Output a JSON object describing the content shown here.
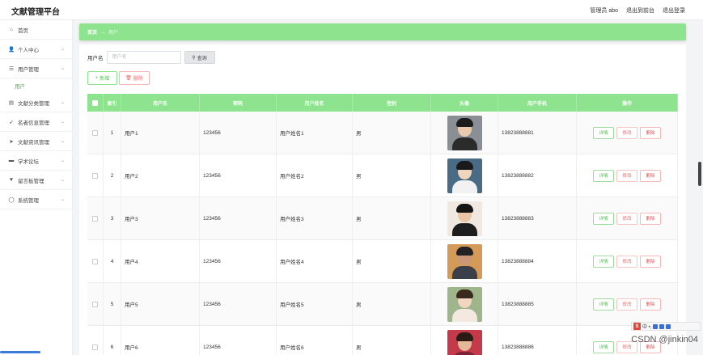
{
  "app": {
    "title": "文献管理平台",
    "top_user": "管理员 abo",
    "top_links": [
      "退出到前台",
      "退出登录"
    ]
  },
  "sidebar": {
    "items": [
      {
        "label": "首页",
        "icon": "home-icon",
        "glyph": "⌂",
        "chev": false
      },
      {
        "label": "个人中心",
        "icon": "user-icon",
        "glyph": "👤",
        "chev": true
      },
      {
        "label": "用户管理",
        "icon": "list-icon",
        "glyph": "☰",
        "chev": true,
        "sub": "用户"
      },
      {
        "label": "文献分类管理",
        "icon": "folder-icon",
        "glyph": "▤",
        "chev": true
      },
      {
        "label": "名者信息管理",
        "icon": "send-icon",
        "glyph": "➶",
        "chev": true
      },
      {
        "label": "文献资讯管理",
        "icon": "send-icon",
        "glyph": "➤",
        "chev": true
      },
      {
        "label": "学术论坛",
        "icon": "forum-icon",
        "glyph": "▬",
        "chev": true
      },
      {
        "label": "留言板管理",
        "icon": "message-icon",
        "glyph": "▼",
        "chev": true
      },
      {
        "label": "系统管理",
        "icon": "gear-icon",
        "glyph": "◯",
        "chev": true
      }
    ]
  },
  "breadcrumb": {
    "home": "首页",
    "sep": "→",
    "current": "用户"
  },
  "search": {
    "label": "用户名",
    "placeholder": "用户名",
    "value": "",
    "button": "查询"
  },
  "actions": {
    "add": "新增",
    "delete": "删除"
  },
  "table": {
    "headers": {
      "index": "索引",
      "username": "用户名",
      "password": "密码",
      "realname": "用户姓名",
      "sex": "性别",
      "avatar": "头像",
      "phone": "用户手机",
      "ops": "操作"
    },
    "ops": {
      "detail": "详情",
      "edit": "修改",
      "delete": "删除"
    },
    "rows": [
      {
        "index": "1",
        "username": "用户1",
        "password": "123456",
        "realname": "用户姓名1",
        "sex": "男",
        "phone": "13823888881",
        "avatar_colors": {
          "bg": "#8a8f96",
          "hair": "#1c1c1c",
          "skin": "#e8c9ae",
          "body": "#2b2b2b"
        }
      },
      {
        "index": "2",
        "username": "用户2",
        "password": "123456",
        "realname": "用户姓名2",
        "sex": "男",
        "phone": "13823888882",
        "avatar_colors": {
          "bg": "#4a6b86",
          "hair": "#1a1a1a",
          "skin": "#f0d5bd",
          "body": "#f2f2f2"
        }
      },
      {
        "index": "3",
        "username": "用户3",
        "password": "123456",
        "realname": "用户姓名3",
        "sex": "男",
        "phone": "13823888883",
        "avatar_colors": {
          "bg": "#efe9e2",
          "hair": "#151515",
          "skin": "#eac6a6",
          "body": "#1e1e1e"
        }
      },
      {
        "index": "4",
        "username": "用户4",
        "password": "123456",
        "realname": "用户姓名4",
        "sex": "男",
        "phone": "13823888884",
        "avatar_colors": {
          "bg": "#d49a58",
          "hair": "#222",
          "skin": "#c99777",
          "body": "#3a3f4a"
        }
      },
      {
        "index": "5",
        "username": "用户5",
        "password": "123456",
        "realname": "用户姓名5",
        "sex": "男",
        "phone": "13823888885",
        "avatar_colors": {
          "bg": "#9fb58c",
          "hair": "#3a2a1e",
          "skin": "#f2d6c2",
          "body": "#f4e9e0"
        }
      },
      {
        "index": "6",
        "username": "用户6",
        "password": "123456",
        "realname": "用户姓名6",
        "sex": "男",
        "phone": "13823888886",
        "avatar_colors": {
          "bg": "#c53a4a",
          "hair": "#2a1b14",
          "skin": "#e4b898",
          "body": "#7a2435"
        }
      }
    ]
  },
  "watermark": "CSDN @jinkin04",
  "tray": {
    "logo": "S",
    "text": "中 •,"
  }
}
